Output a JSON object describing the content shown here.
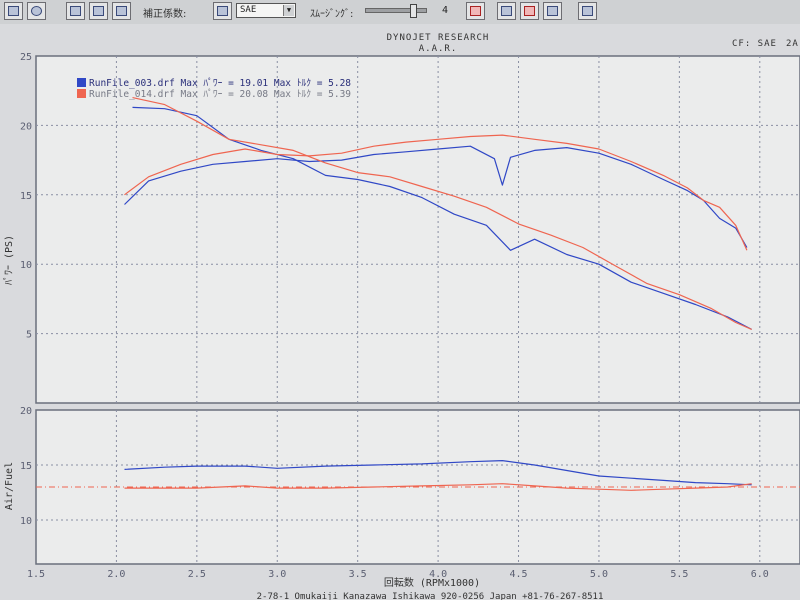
{
  "toolbar": {
    "correction_label": "補正係数:",
    "standard": "SAE",
    "smoothing_label": "ｽﾑｰｼﾞﾝｸﾞ:",
    "smoothing_value": "4",
    "smoothing_level": 4,
    "smoothing_max": 5
  },
  "header": {
    "title": "DYNOJET  RESEARCH",
    "subtitle": "A.A.R.",
    "cf": "CF: SAE",
    "page": "2A"
  },
  "footer": {
    "text": "2-78-1 Omukaiji Kanazawa Ishikawa 920-0256 Japan  +81-76-267-8511"
  },
  "colors": {
    "run1": "#3048c6",
    "run2": "#ef6550",
    "background": "#ebecec",
    "grid": "#8a8fa3"
  },
  "chart_data": [
    {
      "type": "line",
      "ylabel": "ﾊﾟﾜｰ (PS)",
      "xlabel": "",
      "xlim": [
        1.5,
        6.25
      ],
      "ylim": [
        0,
        25
      ],
      "x_ticks": [
        "1.5",
        "2.0",
        "2.5",
        "3.0",
        "3.5",
        "4.0",
        "4.5",
        "5.0",
        "5.5",
        "6.0"
      ],
      "y_ticks": [
        "5",
        "10",
        "15",
        "20",
        "25"
      ],
      "legend": [
        {
          "name": "RunFile_003.drf",
          "text": "RunFile_003.drf Max ﾊﾟﾜｰ = 19.01   Max ﾄﾙｸ = 5.28",
          "color": "#3048c6"
        },
        {
          "name": "RunFile_014.drf",
          "text": "RunFile_014.drf Max ﾊﾟﾜｰ = 20.08   Max ﾄﾙｸ = 5.39",
          "color": "#ef6550"
        }
      ],
      "series": [
        {
          "name": "RunFile_003.drf",
          "metric": "power",
          "color": "#3048c6",
          "x": [
            2.05,
            2.2,
            2.4,
            2.6,
            2.8,
            3.0,
            3.2,
            3.4,
            3.6,
            3.8,
            4.0,
            4.2,
            4.35,
            4.4,
            4.45,
            4.6,
            4.8,
            5.0,
            5.2,
            5.4,
            5.55,
            5.65,
            5.75,
            5.85,
            5.92
          ],
          "y": [
            14.3,
            16.0,
            16.7,
            17.2,
            17.4,
            17.6,
            17.4,
            17.5,
            17.9,
            18.1,
            18.3,
            18.5,
            17.6,
            15.7,
            17.7,
            18.2,
            18.4,
            18.0,
            17.2,
            16.1,
            15.3,
            14.6,
            13.3,
            12.6,
            11.2
          ]
        },
        {
          "name": "RunFile_003.drf",
          "metric": "torque",
          "color": "#3048c6",
          "x": [
            2.1,
            2.3,
            2.5,
            2.7,
            2.9,
            3.1,
            3.3,
            3.5,
            3.7,
            3.9,
            4.1,
            4.3,
            4.45,
            4.6,
            4.8,
            5.0,
            5.2,
            5.4,
            5.6,
            5.8,
            5.95
          ],
          "y": [
            21.3,
            21.2,
            20.7,
            19.0,
            18.2,
            17.6,
            16.4,
            16.1,
            15.6,
            14.8,
            13.6,
            12.8,
            11.0,
            11.8,
            10.7,
            10.0,
            8.7,
            7.9,
            7.1,
            6.2,
            5.3
          ]
        },
        {
          "name": "RunFile_014.drf",
          "metric": "power",
          "color": "#ef6550",
          "x": [
            2.05,
            2.2,
            2.4,
            2.6,
            2.8,
            3.0,
            3.2,
            3.4,
            3.6,
            3.8,
            4.0,
            4.2,
            4.4,
            4.6,
            4.8,
            5.0,
            5.2,
            5.4,
            5.55,
            5.65,
            5.75,
            5.85,
            5.92
          ],
          "y": [
            15.0,
            16.3,
            17.2,
            17.9,
            18.3,
            17.9,
            17.8,
            18.0,
            18.5,
            18.8,
            19.0,
            19.2,
            19.3,
            19.0,
            18.7,
            18.3,
            17.4,
            16.4,
            15.5,
            14.6,
            14.1,
            12.8,
            11.0
          ]
        },
        {
          "name": "RunFile_014.drf",
          "metric": "torque",
          "color": "#ef6550",
          "x": [
            2.1,
            2.3,
            2.5,
            2.7,
            2.9,
            3.1,
            3.3,
            3.5,
            3.7,
            3.9,
            4.1,
            4.3,
            4.5,
            4.7,
            4.9,
            5.1,
            5.3,
            5.5,
            5.7,
            5.85,
            5.95
          ],
          "y": [
            22.0,
            21.5,
            20.3,
            19.0,
            18.6,
            18.2,
            17.3,
            16.6,
            16.3,
            15.6,
            14.9,
            14.1,
            12.9,
            12.1,
            11.2,
            9.9,
            8.6,
            7.8,
            6.8,
            5.8,
            5.3
          ]
        }
      ]
    },
    {
      "type": "line",
      "ylabel": "Air/Fuel",
      "xlabel": "回転数 (RPMx1000)",
      "xlim": [
        1.5,
        6.25
      ],
      "ylim": [
        6,
        20
      ],
      "x_ticks": [
        "1.5",
        "2.0",
        "2.5",
        "3.0",
        "3.5",
        "4.0",
        "4.5",
        "5.0",
        "5.5",
        "6.0"
      ],
      "y_ticks": [
        "10",
        "15",
        "20"
      ],
      "reference_line": 13.0,
      "series": [
        {
          "name": "RunFile_003.drf",
          "color": "#3048c6",
          "x": [
            2.05,
            2.3,
            2.5,
            2.8,
            3.0,
            3.3,
            3.6,
            3.9,
            4.2,
            4.4,
            4.6,
            4.8,
            5.0,
            5.2,
            5.4,
            5.6,
            5.8,
            5.95
          ],
          "y": [
            14.6,
            14.8,
            14.9,
            14.9,
            14.7,
            14.9,
            15.0,
            15.1,
            15.3,
            15.4,
            15.0,
            14.5,
            14.0,
            13.8,
            13.6,
            13.4,
            13.3,
            13.2
          ]
        },
        {
          "name": "RunFile_014.drf",
          "color": "#ef6550",
          "x": [
            2.05,
            2.3,
            2.5,
            2.8,
            3.0,
            3.3,
            3.6,
            3.9,
            4.2,
            4.4,
            4.6,
            4.8,
            5.0,
            5.2,
            5.4,
            5.6,
            5.8,
            5.95
          ],
          "y": [
            12.9,
            12.9,
            12.9,
            13.1,
            12.9,
            12.9,
            13.0,
            13.1,
            13.2,
            13.3,
            13.1,
            12.9,
            12.8,
            12.7,
            12.8,
            12.9,
            13.0,
            13.3
          ]
        }
      ]
    }
  ]
}
